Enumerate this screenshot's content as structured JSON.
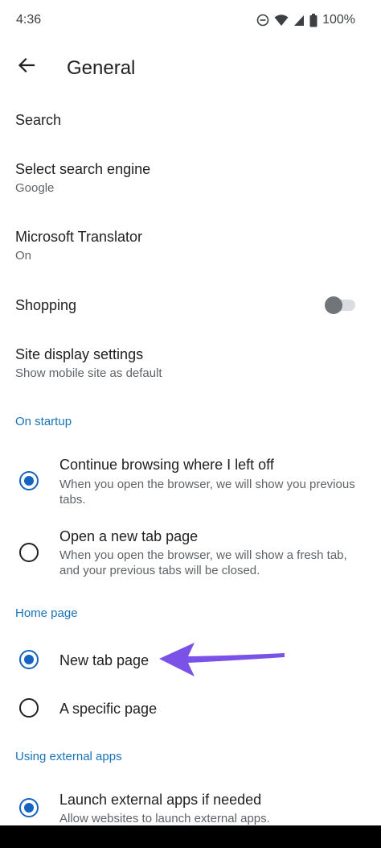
{
  "status_bar": {
    "time": "4:36",
    "battery": "100%",
    "icons": [
      "dnd-icon",
      "wifi-icon",
      "signal-icon",
      "battery-icon"
    ]
  },
  "header": {
    "title": "General",
    "back_icon": "arrow-left-icon"
  },
  "settings": {
    "search": {
      "title": "Search"
    },
    "search_engine": {
      "title": "Select search engine",
      "summary": "Google"
    },
    "translator": {
      "title": "Microsoft Translator",
      "summary": "On"
    },
    "shopping": {
      "title": "Shopping",
      "enabled": false
    },
    "site_display": {
      "title": "Site display settings",
      "summary": "Show mobile site as default"
    }
  },
  "on_startup": {
    "header": "On startup",
    "options": [
      {
        "title": "Continue browsing where I left off",
        "summary": "When you open the browser, we will show you previous tabs.",
        "selected": true
      },
      {
        "title": "Open a new tab page",
        "summary": "When you open the browser, we will show a fresh tab, and your previous tabs will be closed.",
        "selected": false
      }
    ]
  },
  "home_page": {
    "header": "Home page",
    "options": [
      {
        "title": "New tab page",
        "selected": true
      },
      {
        "title": "A specific page",
        "selected": false
      }
    ]
  },
  "external_apps": {
    "header": "Using external apps",
    "options": [
      {
        "title": "Launch external apps if needed",
        "summary": "Allow websites to launch external apps.",
        "selected": true
      }
    ]
  },
  "colors": {
    "accent": "#1565c0",
    "section_header": "#1a73b8",
    "annotation_arrow": "#7b52e8"
  }
}
